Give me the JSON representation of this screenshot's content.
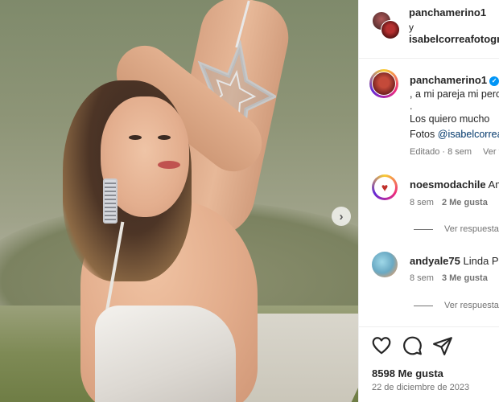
{
  "post": {
    "image_alt": "Mujer con vestido blanco sosteniendo una estrella plateada"
  },
  "header": {
    "author": "panchamerino1",
    "conjunction": "y",
    "coauthor": "isabelcorreafotografa"
  },
  "caption": {
    "author": "panchamerino1",
    "verified": true,
    "lines": [
      ", a mi pareja mi pero",
      ".",
      "Los quiero mucho ",
      "Fotos "
    ],
    "mention": "@isabelcorreafotografa",
    "edited": "Editado · 8 sem",
    "translate": "Ver traducción"
  },
  "comments": [
    {
      "user": "noesmodachile",
      "text": "Am",
      "time": "8 sem",
      "likes": "2 Me gusta",
      "replies_label": "Ver respuestas"
    },
    {
      "user": "andyale75",
      "text": "Linda Pa",
      "time": "8 sem",
      "likes": "3 Me gusta",
      "replies_label": "Ver respuestas"
    }
  ],
  "actions": {
    "like": "heart-icon",
    "comment": "comment-icon",
    "share": "share-icon"
  },
  "likes_count": "8598 Me gusta",
  "date": "22 de diciembre de 2023",
  "colors": {
    "verified": "#0095f6",
    "text": "#262626",
    "muted": "#737373",
    "link": "#00376b"
  }
}
